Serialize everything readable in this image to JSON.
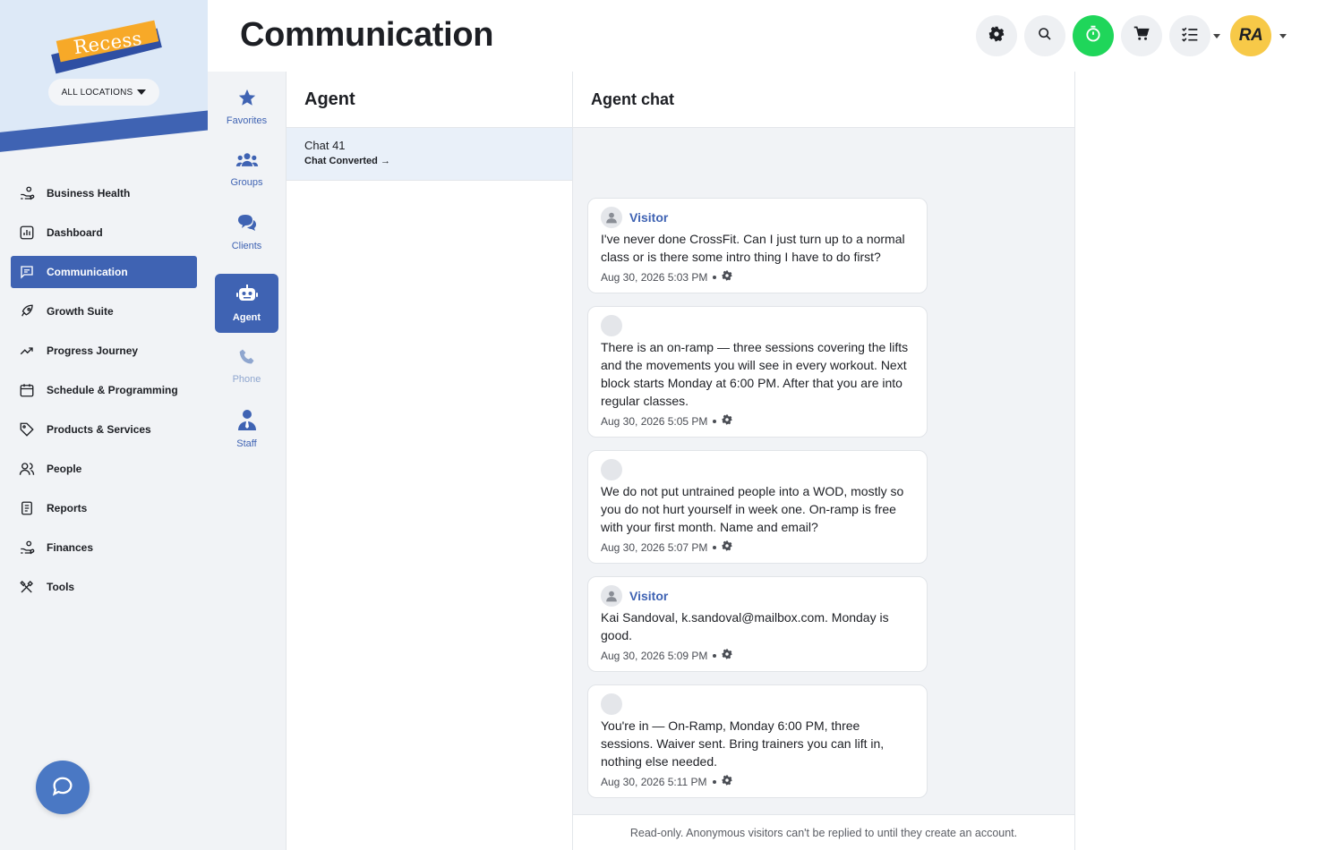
{
  "brand": {
    "logo_text": "Recess",
    "locations_label": "ALL LOCATIONS"
  },
  "nav": {
    "items": [
      {
        "label": "Business Health",
        "icon": "hand-coins-icon"
      },
      {
        "label": "Dashboard",
        "icon": "chart-icon"
      },
      {
        "label": "Communication",
        "icon": "message-icon",
        "active": true
      },
      {
        "label": "Growth Suite",
        "icon": "rocket-icon"
      },
      {
        "label": "Progress Journey",
        "icon": "trending-up-icon"
      },
      {
        "label": "Schedule & Programming",
        "icon": "calendar-icon"
      },
      {
        "label": "Products & Services",
        "icon": "tag-icon"
      },
      {
        "label": "People",
        "icon": "people-icon"
      },
      {
        "label": "Reports",
        "icon": "document-icon"
      },
      {
        "label": "Finances",
        "icon": "hand-coins-icon"
      },
      {
        "label": "Tools",
        "icon": "tools-icon"
      }
    ]
  },
  "subnav": {
    "items": [
      {
        "label": "Favorites",
        "icon": "star-icon"
      },
      {
        "label": "Groups",
        "icon": "group-icon"
      },
      {
        "label": "Clients",
        "icon": "chat-bubbles-icon"
      },
      {
        "label": "Agent",
        "icon": "robot-icon",
        "active": true
      },
      {
        "label": "Phone",
        "icon": "phone-icon",
        "disabled": true
      },
      {
        "label": "Staff",
        "icon": "staff-icon"
      }
    ]
  },
  "header": {
    "title": "Communication",
    "avatar_initials": "RA",
    "buttons": [
      "gear-icon",
      "search-icon",
      "timer-icon",
      "cart-icon",
      "checklist-icon"
    ]
  },
  "agent_list": {
    "title": "Agent",
    "chat": {
      "title": "Chat 41",
      "status": "Chat Converted"
    }
  },
  "agent_chat": {
    "title": "Agent chat",
    "messages": [
      {
        "sender": "Visitor",
        "text": "I've never done CrossFit. Can I just turn up to a normal class or is there some intro thing I have to do first?",
        "time": "Aug 30, 2026 5:03 PM"
      },
      {
        "sender": "",
        "text": "There is an on-ramp — three sessions covering the lifts and the movements you will see in every workout. Next block starts Monday at 6:00 PM. After that you are into regular classes.",
        "time": "Aug 30, 2026 5:05 PM"
      },
      {
        "sender": "",
        "text": "We do not put untrained people into a WOD, mostly so you do not hurt yourself in week one. On-ramp is free with your first month. Name and email?",
        "time": "Aug 30, 2026 5:07 PM"
      },
      {
        "sender": "Visitor",
        "text": "Kai Sandoval, k.sandoval@mailbox.com. Monday is good.",
        "time": "Aug 30, 2026 5:09 PM"
      },
      {
        "sender": "",
        "text": "You're in — On-Ramp, Monday 6:00 PM, three sessions. Waiver sent. Bring trainers you can lift in, nothing else needed.",
        "time": "Aug 30, 2026 5:11 PM"
      }
    ],
    "footer": "Read-only. Anonymous visitors can't be replied to until they create an account."
  },
  "colors": {
    "accent": "#3f63b3",
    "timer": "#1fd65a",
    "avatar": "#f7c948"
  }
}
